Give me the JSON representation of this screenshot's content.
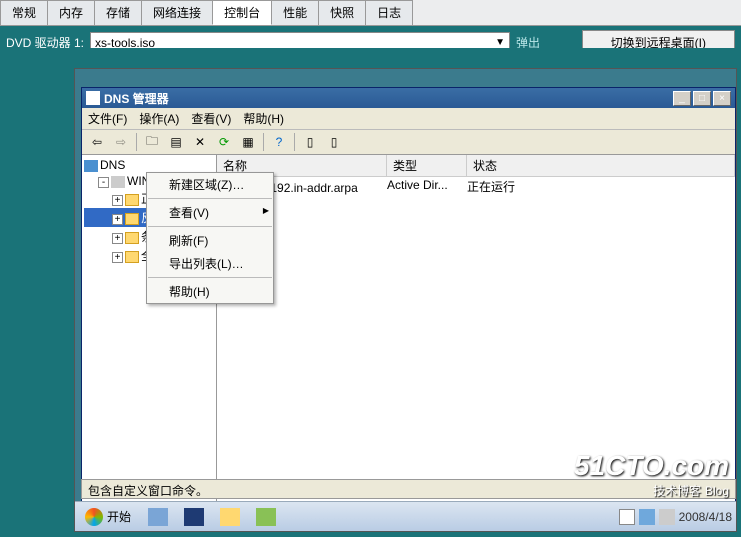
{
  "outerTabs": [
    "常规",
    "内存",
    "存储",
    "网络连接",
    "控制台",
    "性能",
    "快照",
    "日志"
  ],
  "activeOuterTab": 4,
  "dvd": {
    "label": "DVD 驱动器 1:",
    "value": "xs-tools.iso",
    "eject": "弹出",
    "remote": "切换到远程桌面(I)"
  },
  "dnsWindow": {
    "title": "DNS 管理器",
    "menus": [
      "文件(F)",
      "操作(A)",
      "查看(V)",
      "帮助(H)"
    ],
    "tree": {
      "root": "DNS",
      "server": "WIN-IFL33DBE90K",
      "nodes": [
        {
          "label": "正向查找区域",
          "selected": false
        },
        {
          "label": "反向查找区域",
          "selected": true
        },
        {
          "label": "条件转发器",
          "selected": false
        },
        {
          "label": "全局日志",
          "selected": false
        }
      ]
    },
    "listHeaders": {
      "name": "名称",
      "type": "类型",
      "status": "状态"
    },
    "listRows": [
      {
        "name": "16.16.192.in-addr.arpa",
        "type": "Active Dir...",
        "status": "正在运行"
      }
    ],
    "statusbar": "包含自定义窗口命令。"
  },
  "contextMenu": {
    "items": [
      {
        "label": "新建区域(Z)…",
        "sep": false
      },
      {
        "label": "",
        "sep": true
      },
      {
        "label": "查看(V)",
        "sub": true
      },
      {
        "label": "",
        "sep": true
      },
      {
        "label": "刷新(F)"
      },
      {
        "label": "导出列表(L)…"
      },
      {
        "label": "",
        "sep": true
      },
      {
        "label": "帮助(H)"
      }
    ]
  },
  "taskbar": {
    "start": "开始",
    "tray": {
      "time": "",
      "date": "2008/4/18"
    }
  },
  "watermark": {
    "line1": "51CTO.com",
    "line2": "技术博客",
    "line3": "Blog"
  }
}
